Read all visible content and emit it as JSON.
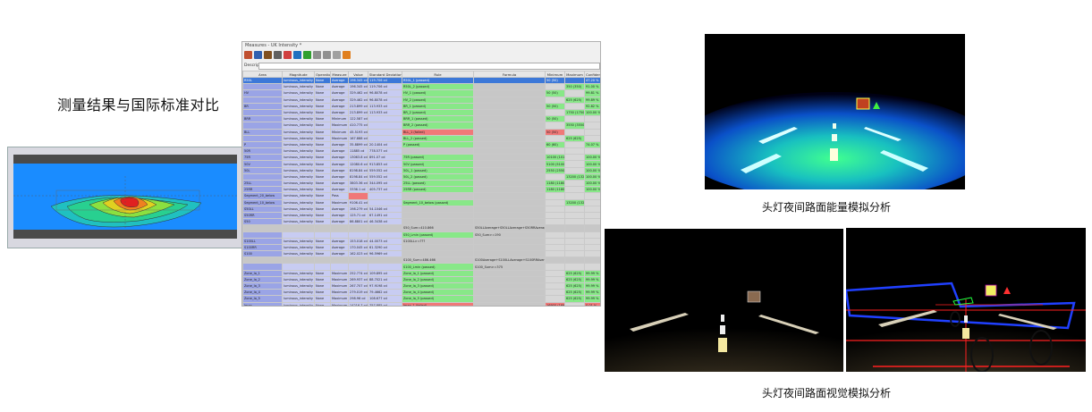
{
  "captions": {
    "left_title": "测量结果与国际标准对比",
    "right_top": "头灯夜间路面能量模拟分析",
    "right_bottom": "头灯夜间路面视觉模拟分析"
  },
  "measure_window": {
    "title": "Measures - UK Intensity *",
    "description_label": "Description:",
    "columns": [
      "Area",
      "Magnitude",
      "Operation",
      "Measure",
      "Value",
      "Standard Deviation",
      "Rule",
      "Formula",
      "Minimum",
      "Maximum",
      "Confidence Level"
    ],
    "rows": [
      {
        "area": "R50L",
        "mag": "luminous_intensity",
        "op": "None",
        "me": "Average",
        "val": "196.345 cd",
        "sd": "119.706 cd",
        "rule": "R50L_1 (passed)",
        "formula": "",
        "min": "50 (50)",
        "max": "",
        "conf": "47.20 %",
        "status": "pass",
        "selected": true
      },
      {
        "area": "",
        "mag": "luminous_intensity",
        "op": "None",
        "me": "Average",
        "val": "196.345 cd",
        "sd": "119.706 cd",
        "rule": "R50L_2 (passed)",
        "formula": "",
        "min": "",
        "max": "350 (350)",
        "conf": "91.00 %",
        "status": "pass"
      },
      {
        "area": "HV",
        "mag": "luminous_intensity",
        "op": "None",
        "me": "Average",
        "val": "329.462 cd",
        "sd": "96.8078 cd",
        "rule": "HV_1 (passed)",
        "formula": "",
        "min": "50 (50)",
        "max": "",
        "conf": "99.81 %",
        "status": "pass"
      },
      {
        "area": "",
        "mag": "luminous_intensity",
        "op": "None",
        "me": "Average",
        "val": "329.462 cd",
        "sd": "96.8078 cd",
        "rule": "HV_2 (passed)",
        "formula": "",
        "min": "",
        "max": "625 (625)",
        "conf": "99.89 %",
        "status": "pass"
      },
      {
        "area": "BR",
        "mag": "luminous_intensity",
        "op": "None",
        "me": "Average",
        "val": "213.899 cd",
        "sd": "113.933 cd",
        "rule": "BR_1 (passed)",
        "formula": "",
        "min": "50 (50)",
        "max": "",
        "conf": "92.82 %",
        "status": "pass"
      },
      {
        "area": "",
        "mag": "luminous_intensity",
        "op": "None",
        "me": "Average",
        "val": "213.899 cd",
        "sd": "113.933 cd",
        "rule": "BR_2 (passed)",
        "formula": "",
        "min": "",
        "max": "1750 (1750)",
        "conf": "100.00 %",
        "status": "pass"
      },
      {
        "area": "BRR",
        "mag": "luminous_intensity",
        "op": "None",
        "me": "Minimum",
        "val": "122.587 cd",
        "sd": "",
        "rule": "BRR_1 (passed)",
        "formula": "",
        "min": "50 (50)",
        "max": "",
        "conf": "",
        "status": "pass"
      },
      {
        "area": "",
        "mag": "luminous_intensity",
        "op": "None",
        "me": "Maximum",
        "val": "410.775 cd",
        "sd": "",
        "rule": "BRR_2 (passed)",
        "formula": "",
        "min": "",
        "max": "3550 (3550)",
        "conf": "",
        "status": "pass"
      },
      {
        "area": "BLL",
        "mag": "luminous_intensity",
        "op": "None",
        "me": "Minimum",
        "val": "45.5193 cd",
        "sd": "",
        "rule": "BLL_1 (failed)",
        "formula": "",
        "min": "50 (50)",
        "max": "",
        "conf": "",
        "status": "fail"
      },
      {
        "area": "",
        "mag": "luminous_intensity",
        "op": "None",
        "me": "Maximum",
        "val": "167.888 cd",
        "sd": "",
        "rule": "BLL_2 (passed)",
        "formula": "",
        "min": "",
        "max": "625 (625)",
        "conf": "",
        "status": "pass"
      },
      {
        "area": "P",
        "mag": "luminous_intensity",
        "op": "None",
        "me": "Average",
        "val": "35.8899 cd",
        "sd": "20.1404 cd",
        "rule": "P (passed)",
        "formula": "",
        "min": "60 (60)",
        "max": "",
        "conf": "74.07 %",
        "status": "pass"
      },
      {
        "area": "50R",
        "mag": "luminous_intensity",
        "op": "None",
        "me": "Average",
        "val": "11885 cd",
        "sd": "778.577 cd",
        "rule": "",
        "formula": "",
        "min": "",
        "max": "",
        "conf": "",
        "status": "none"
      },
      {
        "area": "75R",
        "mag": "luminous_intensity",
        "op": "None",
        "me": "Average",
        "val": "13063.8 cd",
        "sd": "891.07 cd",
        "rule": "75R (passed)",
        "formula": "",
        "min": "10100 (10100)",
        "max": "",
        "conf": "100.00 %",
        "status": "pass"
      },
      {
        "area": "50V",
        "mag": "luminous_intensity",
        "op": "None",
        "me": "Average",
        "val": "12080.6 cd",
        "sd": "913.853 cd",
        "rule": "50V (passed)",
        "formula": "",
        "min": "5100 (5100)",
        "max": "",
        "conf": "100.00 %",
        "status": "pass"
      },
      {
        "area": "50L",
        "mag": "luminous_intensity",
        "op": "None",
        "me": "Average",
        "val": "8198.84 cd",
        "sd": "559.552 cd",
        "rule": "50L_1 (passed)",
        "formula": "",
        "min": "2550 (2550)",
        "max": "",
        "conf": "100.00 %",
        "status": "pass"
      },
      {
        "area": "",
        "mag": "luminous_intensity",
        "op": "None",
        "me": "Average",
        "val": "8198.84 cd",
        "sd": "559.552 cd",
        "rule": "50L_2 (passed)",
        "formula": "",
        "min": "",
        "max": "13200 (13200)",
        "conf": "100.00 %",
        "status": "pass"
      },
      {
        "area": "25LL",
        "mag": "luminous_intensity",
        "op": "None",
        "me": "Average",
        "val": "3803.36 cd",
        "sd": "344.095 cd",
        "rule": "25LL (passed)",
        "formula": "",
        "min": "1180 (1180)",
        "max": "",
        "conf": "100.00 %",
        "status": "pass"
      },
      {
        "area": "25RR",
        "mag": "luminous_intensity",
        "op": "None",
        "me": "Average",
        "val": "3336.1 cd",
        "sd": "405.737 cd",
        "rule": "25RR (passed)",
        "formula": "",
        "min": "1180 (1180)",
        "max": "",
        "conf": "100.00 %",
        "status": "pass"
      },
      {
        "area": "Segment_20_below",
        "mag": "luminous_intensity",
        "op": "None",
        "me": "Pass",
        "val": "",
        "sd": "",
        "rule": "",
        "formula": "",
        "min": "",
        "max": "",
        "conf": "",
        "status": "valred"
      },
      {
        "area": "Segment_10_below",
        "mag": "luminous_intensity",
        "op": "None",
        "me": "Maximum",
        "val": "9106.41 cd",
        "sd": "",
        "rule": "Segment_10_below (passed)",
        "formula": "",
        "min": "",
        "max": "13200 (13200)",
        "conf": "",
        "status": "pass"
      },
      {
        "area": "S50LL",
        "mag": "luminous_intensity",
        "op": "None",
        "me": "Average",
        "val": "198.279 cd",
        "sd": "54.1046 cd",
        "rule": "",
        "formula": "",
        "min": "",
        "max": "",
        "conf": "",
        "status": "none"
      },
      {
        "area": "S50RR",
        "mag": "luminous_intensity",
        "op": "None",
        "me": "Average",
        "val": "125.71 cd",
        "sd": "67.1491 cd",
        "rule": "",
        "formula": "",
        "min": "",
        "max": "",
        "conf": "",
        "status": "none"
      },
      {
        "area": "S50",
        "mag": "luminous_intensity",
        "op": "None",
        "me": "Average",
        "val": "86.8801 cd",
        "sd": "46.3438 cd",
        "rule": "",
        "formula": "",
        "min": "",
        "max": "",
        "conf": "",
        "status": "none"
      },
      {
        "area": "",
        "mag": "",
        "op": "",
        "me": "",
        "val": "",
        "sd": "",
        "rule": "S50_Sum=410.866",
        "formula": "S50LLAverage+S50LLAverage+S50RRAverage",
        "min": "",
        "max": "",
        "conf": "",
        "status": "gray"
      },
      {
        "area": "",
        "mag": "",
        "op": "",
        "me": "",
        "val": "",
        "sd": "",
        "rule": "S50_Lmin (passed)",
        "formula": "S50_Sum>=190",
        "min": "",
        "max": "",
        "conf": "",
        "status": "pass"
      },
      {
        "area": "S100LL",
        "mag": "luminous_intensity",
        "op": "None",
        "me": "Average",
        "val": "153.018 cd",
        "sd": "44.0073 cd",
        "rule": "S100LL>=???",
        "formula": "",
        "min": "",
        "max": "",
        "conf": "",
        "status": "none"
      },
      {
        "area": "S100RR",
        "mag": "luminous_intensity",
        "op": "None",
        "me": "Average",
        "val": "170.045 cd",
        "sd": "61.3290 cd",
        "rule": "",
        "formula": "",
        "min": "",
        "max": "",
        "conf": "",
        "status": "none"
      },
      {
        "area": "S100",
        "mag": "luminous_intensity",
        "op": "None",
        "me": "Average",
        "val": "162.023 cd",
        "sd": "96.5969 cd",
        "rule": "",
        "formula": "",
        "min": "",
        "max": "",
        "conf": "",
        "status": "none"
      },
      {
        "area": "",
        "mag": "",
        "op": "",
        "me": "",
        "val": "",
        "sd": "",
        "rule": "S100_Sum=486.466",
        "formula": "S100Average+S100LLAverage+S100RRAverage",
        "min": "",
        "max": "",
        "conf": "",
        "status": "gray"
      },
      {
        "area": "",
        "mag": "",
        "op": "",
        "me": "",
        "val": "",
        "sd": "",
        "rule": "S100_Lmin (passed)",
        "formula": "S100_Sum>=375",
        "min": "",
        "max": "",
        "conf": "",
        "status": "pass"
      },
      {
        "area": "Zone_Ia_1",
        "mag": "luminous_intensity",
        "op": "None",
        "me": "Maximum",
        "val": "252.774 cd",
        "sd": "109.895 cd",
        "rule": "Zone_Ia_1 (passed)",
        "formula": "",
        "min": "",
        "max": "625 (625)",
        "conf": "99.99 %",
        "status": "pass"
      },
      {
        "area": "Zone_Ia_2",
        "mag": "luminous_intensity",
        "op": "None",
        "me": "Maximum",
        "val": "269.937 cd",
        "sd": "88.7021 cd",
        "rule": "Zone_Ia_2 (passed)",
        "formula": "",
        "min": "",
        "max": "625 (625)",
        "conf": "99.99 %",
        "status": "pass"
      },
      {
        "area": "Zone_Ia_3",
        "mag": "luminous_intensity",
        "op": "None",
        "me": "Maximum",
        "val": "267.707 cd",
        "sd": "97.9198 cd",
        "rule": "Zone_Ia_3 (passed)",
        "formula": "",
        "min": "",
        "max": "625 (625)",
        "conf": "99.99 %",
        "status": "pass"
      },
      {
        "area": "Zone_Ia_4",
        "mag": "luminous_intensity",
        "op": "None",
        "me": "Maximum",
        "val": "279.019 cd",
        "sd": "79.4662 cd",
        "rule": "Zone_Ia_4 (passed)",
        "formula": "",
        "min": "",
        "max": "625 (625)",
        "conf": "99.99 %",
        "status": "pass"
      },
      {
        "area": "Zone_Ia_5",
        "mag": "luminous_intensity",
        "op": "None",
        "me": "Maximum",
        "val": "298.96 cd",
        "sd": "108.677 cd",
        "rule": "Zone_Ia_5 (passed)",
        "formula": "",
        "min": "",
        "max": "625 (625)",
        "conf": "99.99 %",
        "status": "pass"
      },
      {
        "area": "Imax",
        "mag": "luminous_intensity",
        "op": "None",
        "me": "Maximum",
        "val": "14216.7 cd",
        "sd": "757.885 cd",
        "rule": "Imax_1 (failed)",
        "formula": "",
        "min": "16900 (16900)",
        "max": "",
        "conf": "0.01 %",
        "status": "imaxfail"
      },
      {
        "area": "",
        "mag": "luminous_intensity",
        "op": "None",
        "me": "Maximum",
        "val": "14216.7 cd",
        "sd": "757.885 cd",
        "rule": "Imax_2 (passed)",
        "formula": "",
        "min": "",
        "max": "44100 (44100)",
        "conf": "100.00 %",
        "status": "pass"
      }
    ]
  },
  "colors": {
    "field_blue": "#1a8cff",
    "pass_green": "#88e888",
    "fail_red": "#f07878",
    "selected_blue": "#3c78d8",
    "area_purple": "#9aa4e6"
  }
}
